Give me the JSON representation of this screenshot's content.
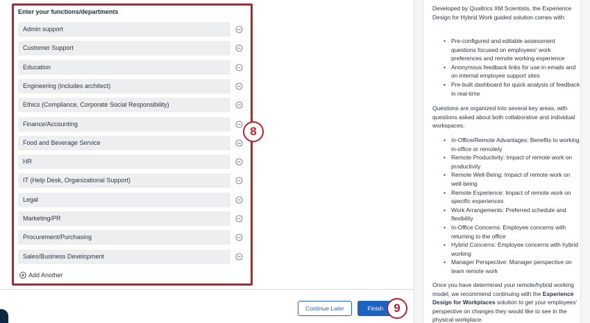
{
  "form": {
    "title": "Enter your functions/departments",
    "items": [
      "Admin support",
      "Customer Support",
      "Education",
      "Engineering (includes architect)",
      "Ethics (Compliance, Corporate Social Responsibility)",
      "Finance/Accounting",
      "Food and Beverage Service",
      "HR",
      "IT (Help Desk, Organizational Support)",
      "Legal",
      "Marketing/PR",
      "Procurement/Purchasing",
      "Sales/Business Development"
    ],
    "add_label": "Add Another"
  },
  "callouts": {
    "step8": "8",
    "step9": "9"
  },
  "footer": {
    "continue_label": "Continue Later",
    "finish_label": "Finish"
  },
  "sidebar": {
    "intro": "Developed by Qualtrics XM Scientists, the Experience Design for Hybrid Work guided solution comes with:",
    "features": [
      "Pre-configured and editable assessment questions focused on employees' work preferences and remote working experience",
      "Anonymous feedback links for use in emails and on internal employee support sites",
      "Pre-built dashboard for quick analysis of feedback in real-time"
    ],
    "areas_intro": "Questions are organized into several key areas, with questions asked about both collaborative and individual workspaces.",
    "areas": [
      "In-Office/Remote Advantages: Benefits to working in-office or remotely",
      "Remote Productivity: Impact of remote work on productivity",
      "Remote Well-Being: Impact of remote work on well-being",
      "Remote Experience: Impact of remote work on specific experiences",
      "Work Arrangements: Preferred schedule and flexibility",
      "In-Office Concerns: Employee concerns with returning to the office",
      "Hybrid Concerns: Employee concerns with hybrid working",
      "Manager Perspective: Manager perspective on team remote work"
    ],
    "closing_pre": "Once you have determined your remote/hybrid working model, we recommend continuing with the ",
    "closing_bold": "Experience Design for Workplaces",
    "closing_post": " solution to get your employees' perspective on changes they would like to see in the physical workplace."
  },
  "colors": {
    "accent_red": "#b5202e",
    "primary_blue": "#1c63c4",
    "item_bg": "#edeef0"
  },
  "icons": {
    "remove": "minus-circle-icon",
    "add": "plus-circle-icon"
  }
}
